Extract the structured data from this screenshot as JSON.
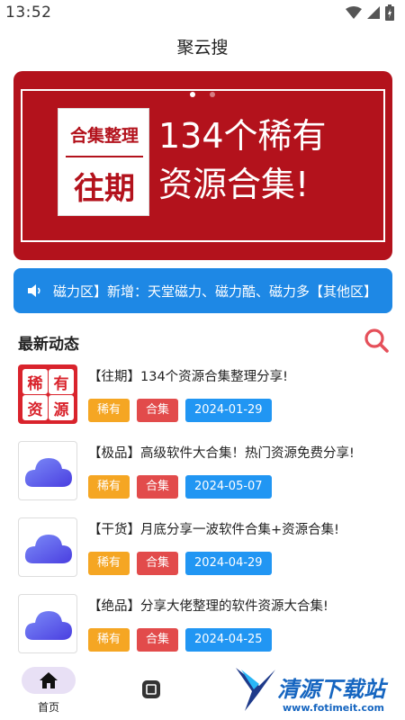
{
  "status_bar": {
    "time": "13:52"
  },
  "app": {
    "title": "聚云搜"
  },
  "banner": {
    "badge_top": "合集整理",
    "badge_bottom": "往期",
    "line1": "134个稀有",
    "line2": "资源合集!",
    "slide_count": 2,
    "active_slide": 1,
    "color": "#b3121c"
  },
  "notice": {
    "icon": "speaker-icon",
    "text": "磁力区】新增：天堂磁力、磁力酷、磁力多【其他区】",
    "color": "#1e88e5"
  },
  "section": {
    "title": "最新动态",
    "search_icon": "search-icon"
  },
  "posts": [
    {
      "title": "【往期】134个资源合集整理分享!",
      "tags": [
        "稀有",
        "合集"
      ],
      "date": "2024-01-29",
      "thumb": "seal",
      "seal_chars": [
        "稀",
        "有",
        "资",
        "源"
      ]
    },
    {
      "title": "【极品】高级软件大合集！热门资源免费分享!",
      "tags": [
        "稀有",
        "合集"
      ],
      "date": "2024-05-07",
      "thumb": "cloud"
    },
    {
      "title": "【干货】月底分享一波软件合集+资源合集!",
      "tags": [
        "稀有",
        "合集"
      ],
      "date": "2024-04-29",
      "thumb": "cloud"
    },
    {
      "title": "【绝品】分享大佬整理的软件资源大合集!",
      "tags": [
        "稀有",
        "合集"
      ],
      "date": "2024-04-25",
      "thumb": "cloud"
    }
  ],
  "tag_colors": {
    "rare": "#f5a623",
    "collection": "#e24b4b",
    "date": "#2196f3"
  },
  "bottom_nav": {
    "home_label": "首页",
    "home_icon": "home-icon",
    "middle_icon": "category-icon"
  },
  "watermark": {
    "text": "清源下载站",
    "url": "www.fotimeit.com"
  }
}
